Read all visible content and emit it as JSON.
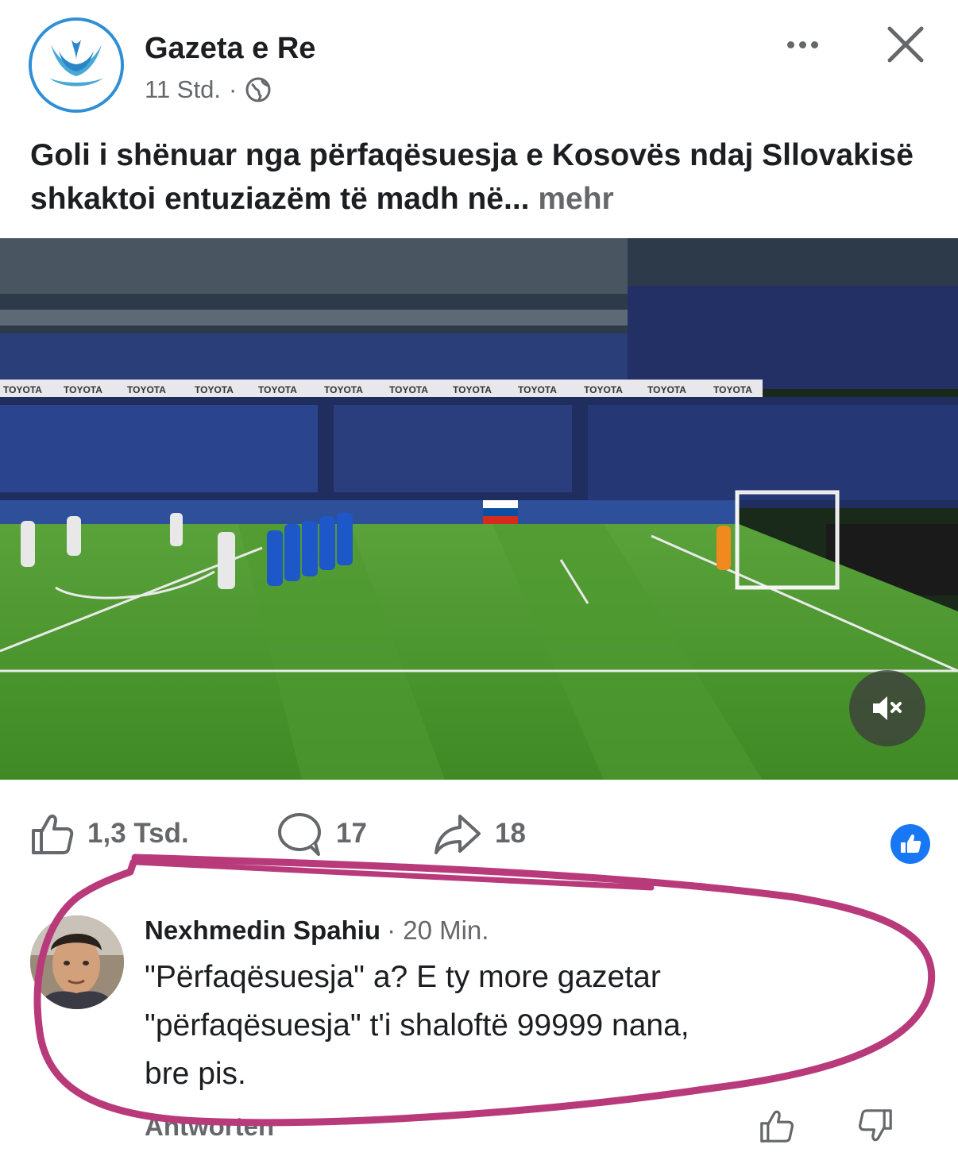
{
  "post": {
    "page_name": "Gazeta e Re",
    "time": "11 Std.",
    "separator": "·",
    "privacy_icon": "globe-icon",
    "text": "Goli i shënuar nga përfaqësuesja e Kosovës ndaj Sllovakisë shkaktoi entuziazëm të madh në...",
    "more_label": "mehr"
  },
  "media": {
    "ad_board": "TOYOTA",
    "mute_icon": "speaker-muted-icon"
  },
  "actions": {
    "likes": "1,3 Tsd.",
    "comments": "17",
    "shares": "18"
  },
  "comment": {
    "author": "Nexhmedin Spahiu",
    "time": "· 20 Min.",
    "lines": [
      "\"Përfaqësuesja\" a? E ty more gazetar",
      "\"përfaqësuesja\" t'i shaloftë 99999 nana,",
      "bre pis."
    ],
    "reply_label": "Antworten"
  },
  "colors": {
    "brand_blue": "#1877f2",
    "muted_text": "#65676b",
    "annotation_stroke": "#b83a7a"
  }
}
